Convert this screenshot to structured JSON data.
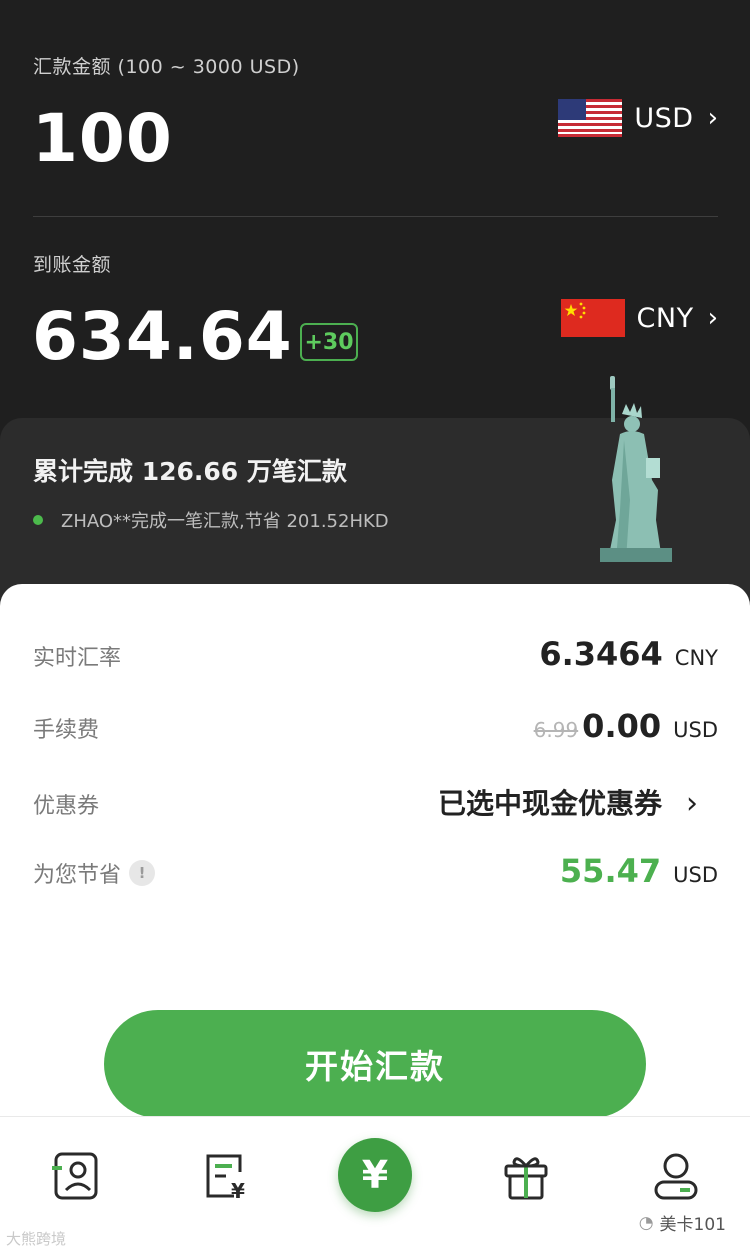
{
  "send": {
    "label": "汇款金额 (100 ~ 3000 USD)",
    "amount": "100",
    "currency": "USD"
  },
  "receive": {
    "label": "到账金额",
    "amount": "634.64",
    "bonus": "+30",
    "currency": "CNY"
  },
  "promo": {
    "title": "累计完成 126.66 万笔汇款",
    "ticker": "ZHAO**完成一笔汇款,节省 201.52HKD"
  },
  "details": {
    "rate_label": "实时汇率",
    "rate_value": "6.3464",
    "rate_unit": "CNY",
    "fee_label": "手续费",
    "fee_original": "6.99",
    "fee_value": "0.00",
    "fee_unit": "USD",
    "coupon_label": "优惠券",
    "coupon_value": "已选中现金优惠券",
    "saving_label": "为您节省",
    "saving_value": "55.47",
    "saving_unit": "USD"
  },
  "cta_label": "开始汇款",
  "center_tab_symbol": "¥",
  "watermark": {
    "left": "大熊跨境",
    "right": "美卡101"
  },
  "colors": {
    "accent_green": "#4caf50",
    "dark_bg": "#1f1f1f"
  }
}
